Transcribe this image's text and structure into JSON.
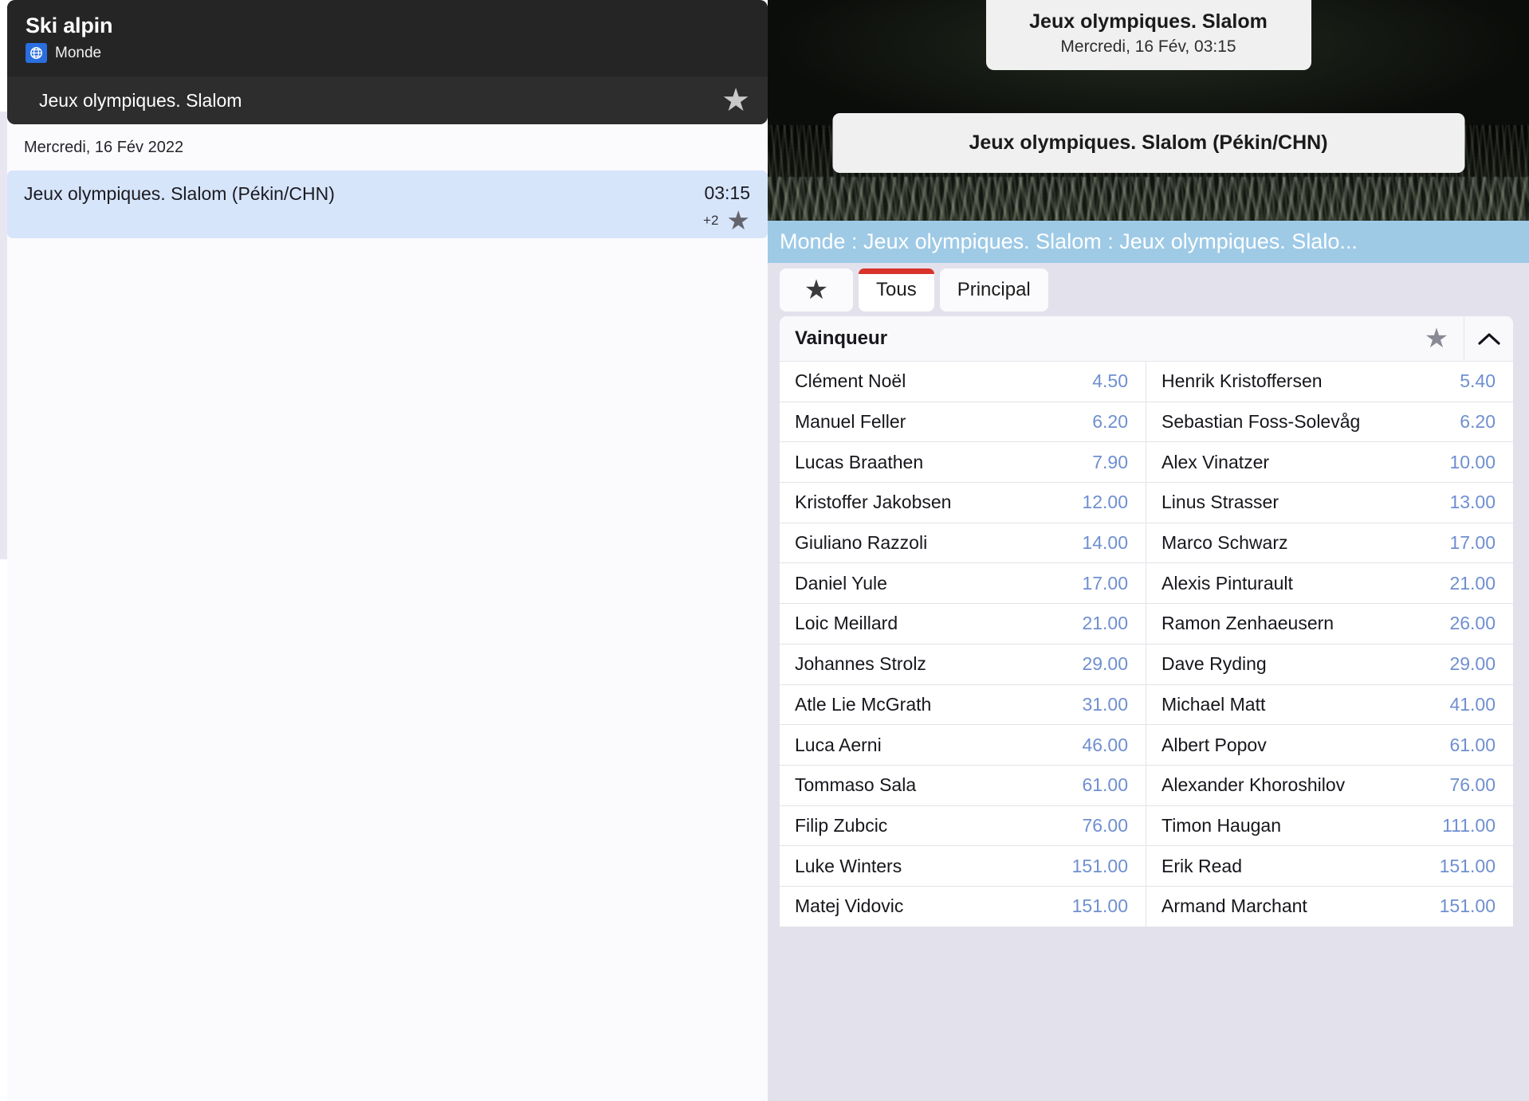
{
  "left": {
    "header": {
      "sport_title": "Ski alpin",
      "region_label": "Monde",
      "region_icon": "globe-icon",
      "event_name": "Jeux olympiques. Slalom",
      "favorite_icon": "star-icon"
    },
    "date_heading": "Mercredi, 16 Fév 2022",
    "match": {
      "name": "Jeux olympiques. Slalom (Pékin/CHN)",
      "time": "03:15",
      "extra_count": "+2",
      "favorite_icon": "star-icon"
    }
  },
  "right": {
    "hero": {
      "title": "Jeux olympiques. Slalom",
      "subtitle": "Mercredi, 16 Fév, 03:15",
      "event_card": "Jeux olympiques. Slalom (Pékin/CHN)"
    },
    "breadcrumb": "Monde : Jeux olympiques. Slalom : Jeux olympiques. Slalo...",
    "tabs": {
      "favorites_icon": "star-icon",
      "items": [
        {
          "label": "Tous",
          "active": true
        },
        {
          "label": "Principal",
          "active": false
        }
      ]
    },
    "odds": {
      "header_title": "Vainqueur",
      "header_star_icon": "star-icon",
      "collapse_icon": "chevron-up-icon",
      "rows": [
        {
          "left_name": "Clément Noël",
          "left_odd": "4.50",
          "right_name": "Henrik Kristoffersen",
          "right_odd": "5.40"
        },
        {
          "left_name": "Manuel Feller",
          "left_odd": "6.20",
          "right_name": "Sebastian Foss-Solevåg",
          "right_odd": "6.20"
        },
        {
          "left_name": "Lucas Braathen",
          "left_odd": "7.90",
          "right_name": "Alex Vinatzer",
          "right_odd": "10.00"
        },
        {
          "left_name": "Kristoffer Jakobsen",
          "left_odd": "12.00",
          "right_name": "Linus Strasser",
          "right_odd": "13.00"
        },
        {
          "left_name": "Giuliano Razzoli",
          "left_odd": "14.00",
          "right_name": "Marco Schwarz",
          "right_odd": "17.00"
        },
        {
          "left_name": "Daniel Yule",
          "left_odd": "17.00",
          "right_name": "Alexis Pinturault",
          "right_odd": "21.00"
        },
        {
          "left_name": "Loic Meillard",
          "left_odd": "21.00",
          "right_name": "Ramon Zenhaeusern",
          "right_odd": "26.00"
        },
        {
          "left_name": "Johannes Strolz",
          "left_odd": "29.00",
          "right_name": "Dave Ryding",
          "right_odd": "29.00"
        },
        {
          "left_name": "Atle Lie McGrath",
          "left_odd": "31.00",
          "right_name": "Michael Matt",
          "right_odd": "41.00"
        },
        {
          "left_name": "Luca Aerni",
          "left_odd": "46.00",
          "right_name": "Albert Popov",
          "right_odd": "61.00"
        },
        {
          "left_name": "Tommaso Sala",
          "left_odd": "61.00",
          "right_name": "Alexander Khoroshilov",
          "right_odd": "76.00"
        },
        {
          "left_name": "Filip Zubcic",
          "left_odd": "76.00",
          "right_name": "Timon Haugan",
          "right_odd": "111.00"
        },
        {
          "left_name": "Luke Winters",
          "left_odd": "151.00",
          "right_name": "Erik Read",
          "right_odd": "151.00"
        },
        {
          "left_name": "Matej Vidovic",
          "left_odd": "151.00",
          "right_name": "Armand Marchant",
          "right_odd": "151.00"
        }
      ]
    }
  },
  "colors": {
    "dark_card": "#252525",
    "highlight_row": "#d7e5fa",
    "breadcrumb_bg": "#9ecae6",
    "panel_bg": "#e2e1ec",
    "odd_value": "#6f8fd0",
    "active_tab_accent": "#d8342c",
    "globe_bg": "#2a6ee0"
  }
}
